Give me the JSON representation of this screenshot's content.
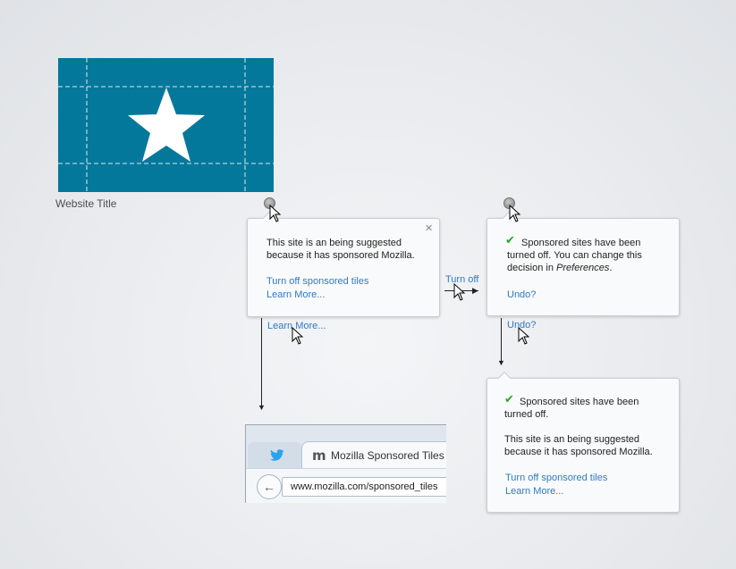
{
  "tile": {
    "title": "Website Title",
    "color": "#03789a"
  },
  "panel_suggested": {
    "line1": "This site is an being suggested",
    "line2": "because it has sponsored Mozilla.",
    "turn_off_link": "Turn off sponsored tiles",
    "learn_more_link": "Learn More..."
  },
  "panel_turned_off": {
    "line1": "Sponsored sites have been",
    "line2": "turned off.  You can change this",
    "line3_prefix": "decision in ",
    "line3_em": "Preferences",
    "line3_suffix": ".",
    "undo_link": "Undo?"
  },
  "panel_combined": {
    "line1": "Sponsored sites have been",
    "line2": "turned off.",
    "line3": "This site is an being suggested",
    "line4": "because it has sponsored Mozilla.",
    "turn_off_link": "Turn off sponsored tiles",
    "learn_more_link": "Learn More..."
  },
  "flow_labels": {
    "turn_off": "Turn off",
    "learn_more": "Learn More...",
    "undo": "Undo?"
  },
  "browser": {
    "tab_label": "Mozilla Sponsored Tiles",
    "url": "www.mozilla.com/sponsored_tiles"
  },
  "colors": {
    "link": "#2f7ac3",
    "check": "#2aa52a"
  }
}
